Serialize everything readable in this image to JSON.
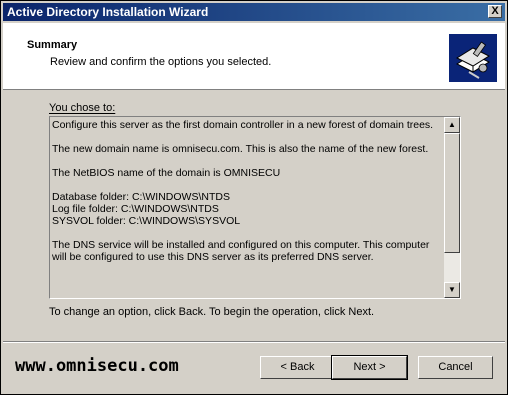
{
  "window": {
    "title": "Active Directory Installation Wizard",
    "close_label": "X"
  },
  "header": {
    "title": "Summary",
    "subtitle": "Review and confirm the options you selected."
  },
  "content": {
    "chose_label": "You chose to:",
    "summary_lines": [
      "Configure this server as the first domain controller in a new forest of domain trees.",
      "The new domain name is omnisecu.com. This is also the name of the new forest.",
      "The NetBIOS name of the domain is OMNISECU",
      "Database folder: C:\\WINDOWS\\NTDS\nLog file folder: C:\\WINDOWS\\NTDS\nSYSVOL folder: C:\\WINDOWS\\SYSVOL",
      "The DNS service will be installed and configured on this computer. This computer will be configured to use this DNS server as its preferred DNS server."
    ],
    "hint": "To change an option, click Back. To begin the operation, click Next."
  },
  "footer": {
    "brand": "www.omnisecu.com",
    "back_label": "< Back",
    "next_label": "Next >",
    "cancel_label": "Cancel"
  },
  "colors": {
    "titlebar_start": "#0a246a",
    "titlebar_end": "#3a6ea5",
    "face": "#d4d0c8",
    "logo_bg": "#0a2478"
  },
  "icons": {
    "wizard_logo": "book-with-key-icon",
    "scroll_up": "arrow-up-icon",
    "scroll_down": "arrow-down-icon"
  }
}
